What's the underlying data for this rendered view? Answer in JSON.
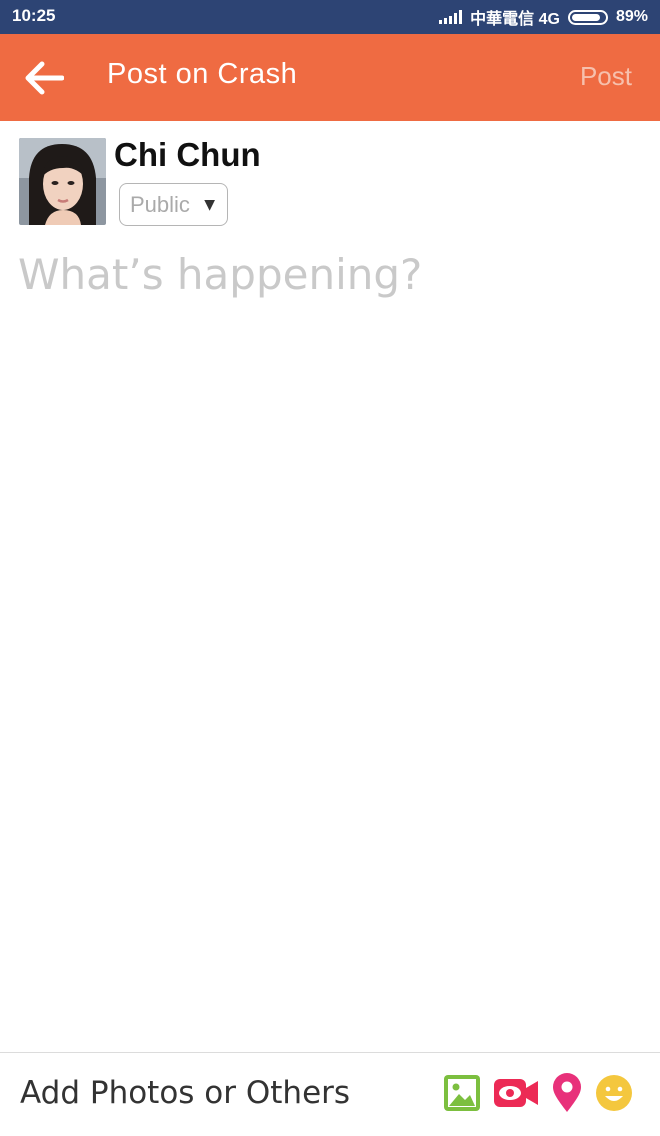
{
  "status_bar": {
    "time": "10:25",
    "carrier": "中華電信 4G",
    "battery_percent": "89%",
    "battery_level": 0.89
  },
  "app_bar": {
    "title": "Post on Crash",
    "post_label": "Post",
    "accent_color": "#ef6b42"
  },
  "composer": {
    "user_name": "Chi Chun",
    "privacy": "Public",
    "placeholder": "What’s happening?"
  },
  "bottom_bar": {
    "label": "Add Photos or Others",
    "icons": [
      "photo-icon",
      "video-icon",
      "location-icon",
      "emoji-icon"
    ]
  }
}
